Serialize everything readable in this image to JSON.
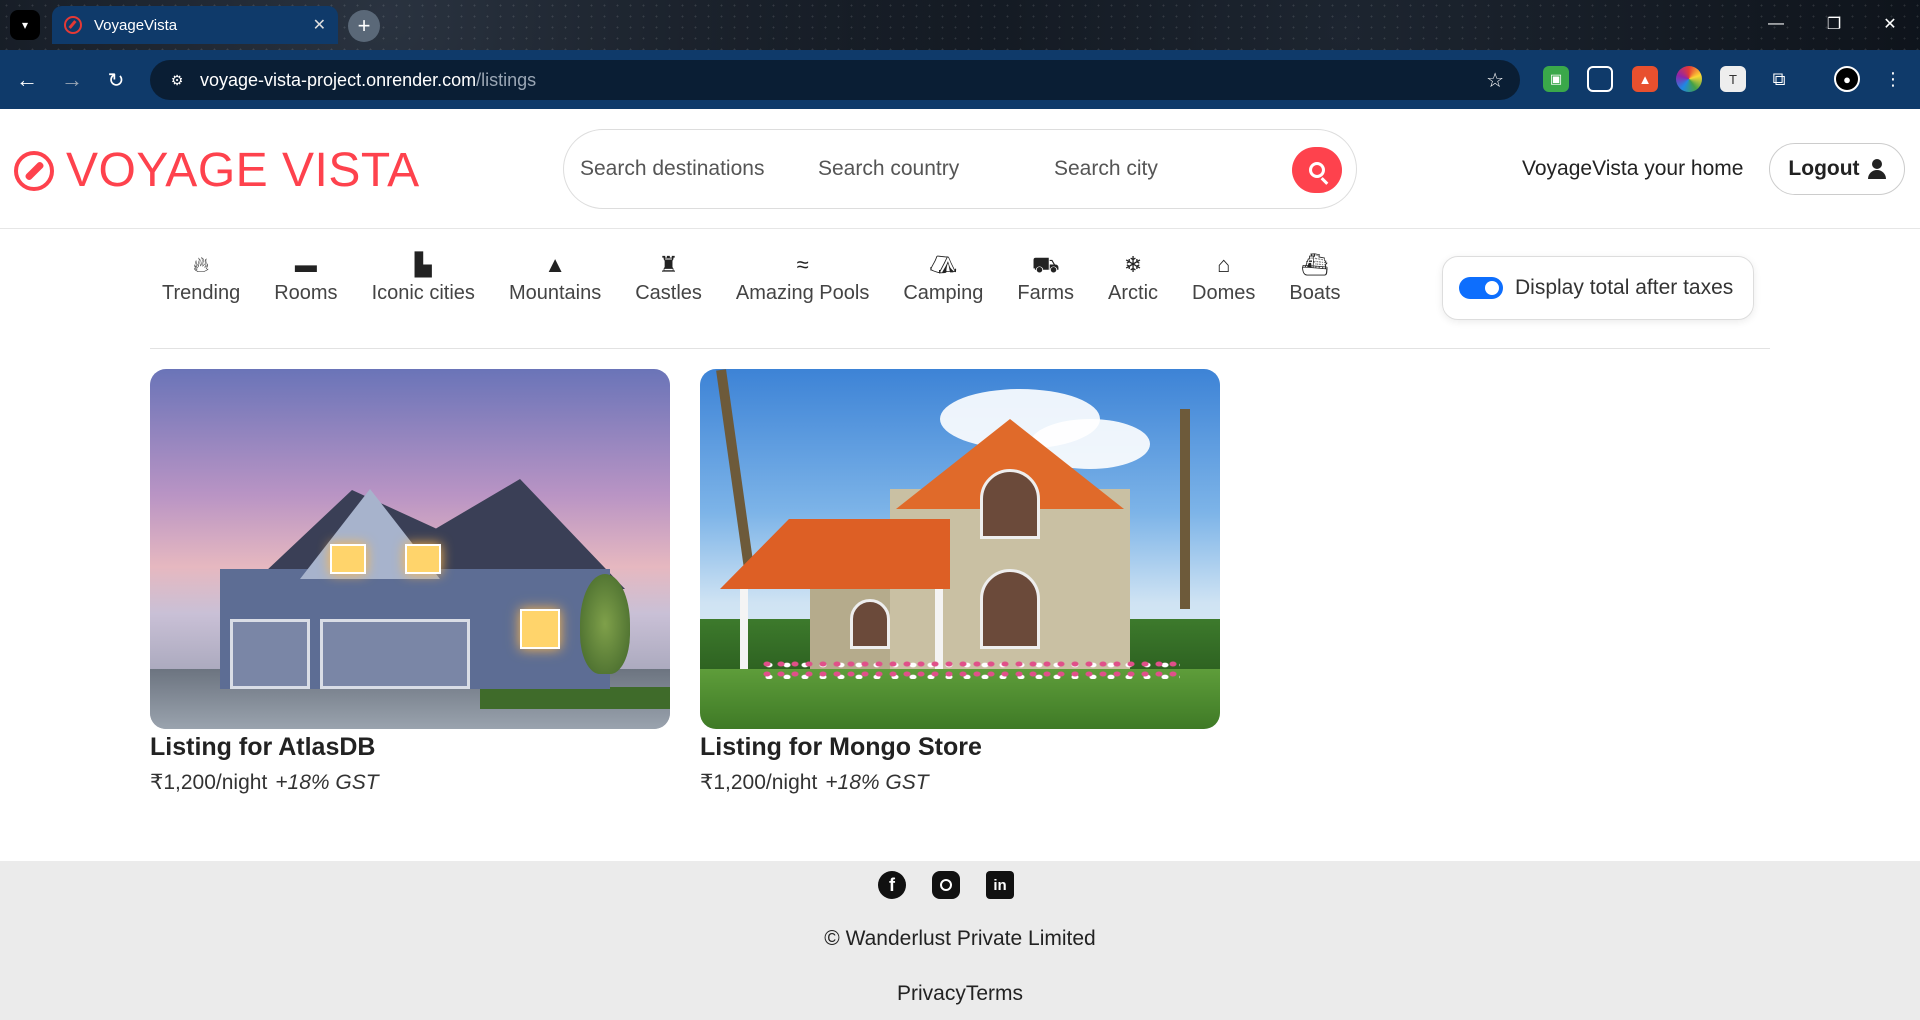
{
  "browser": {
    "tab_title": "VoyageVista",
    "url_host": "voyage-vista-project.onrender.com",
    "url_path": "/listings"
  },
  "navbar": {
    "brand": "VOYAGE VISTA",
    "brand_color": "#fe424d",
    "search": {
      "destinations_placeholder": "Search destinations",
      "country_placeholder": "Search country",
      "city_placeholder": "Search city"
    },
    "tagline": "VoyageVista your home",
    "logout_label": "Logout"
  },
  "filters": [
    {
      "label": "Trending",
      "icon": "fire-icon"
    },
    {
      "label": "Rooms",
      "icon": "bed-icon"
    },
    {
      "label": "Iconic cities",
      "icon": "city-icon"
    },
    {
      "label": "Mountains",
      "icon": "mountain-icon"
    },
    {
      "label": "Castles",
      "icon": "castle-icon"
    },
    {
      "label": "Amazing Pools",
      "icon": "swimmer-icon"
    },
    {
      "label": "Camping",
      "icon": "campground-icon"
    },
    {
      "label": "Farms",
      "icon": "tractor-icon"
    },
    {
      "label": "Arctic",
      "icon": "snowflake-icon"
    },
    {
      "label": "Domes",
      "icon": "dome-icon"
    },
    {
      "label": "Boats",
      "icon": "ship-icon"
    }
  ],
  "tax_toggle": {
    "label": "Display total after taxes",
    "checked": true,
    "accent": "#0d6efd"
  },
  "listings": [
    {
      "title": "Listing for AtlasDB",
      "price": "₹1,200/night",
      "tax_note": "+18% GST"
    },
    {
      "title": "Listing for Mongo Store",
      "price": "₹1,200/night",
      "tax_note": "+18% GST"
    }
  ],
  "footer": {
    "socials": [
      "facebook-icon",
      "instagram-icon",
      "linkedin-icon"
    ],
    "copyright": "© Wanderlust Private Limited",
    "links_text": "PrivacyTerms"
  }
}
